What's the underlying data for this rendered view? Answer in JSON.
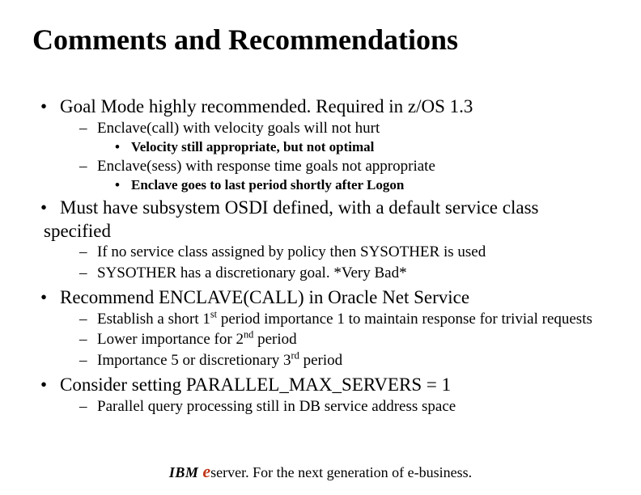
{
  "title": "Comments and Recommendations",
  "bullets": {
    "b1": "Goal Mode highly recommended.  Required in z/OS 1.3",
    "b1a": "Enclave(call) with velocity goals will not hurt",
    "b1a1": "Velocity still appropriate, but not optimal",
    "b1b": "Enclave(sess) with response time goals not appropriate",
    "b1b1": "Enclave goes to last period shortly after Logon",
    "b2": "Must have subsystem OSDI defined, with a default service class specified",
    "b2a": "If no service class assigned by policy then SYSOTHER is used",
    "b2b": "SYSOTHER has a discretionary goal.  *Very Bad*",
    "b3": "Recommend ENCLAVE(CALL) in Oracle Net Service",
    "b3a_pre": "Establish a short 1",
    "b3a_sup": "st",
    "b3a_post": " period importance 1 to maintain response for trivial requests",
    "b3b_pre": "Lower importance for 2",
    "b3b_sup": "nd",
    "b3b_post": " period",
    "b3c_pre": "Importance 5 or discretionary 3",
    "b3c_sup": "rd",
    "b3c_post": " period",
    "b4": "Consider setting PARALLEL_MAX_SERVERS = 1",
    "b4a": "Parallel query processing still in DB service address space"
  },
  "footer": {
    "ibm": "IBM ",
    "e": "e",
    "server": "server.",
    "tagline": " For the next generation of e-business."
  }
}
